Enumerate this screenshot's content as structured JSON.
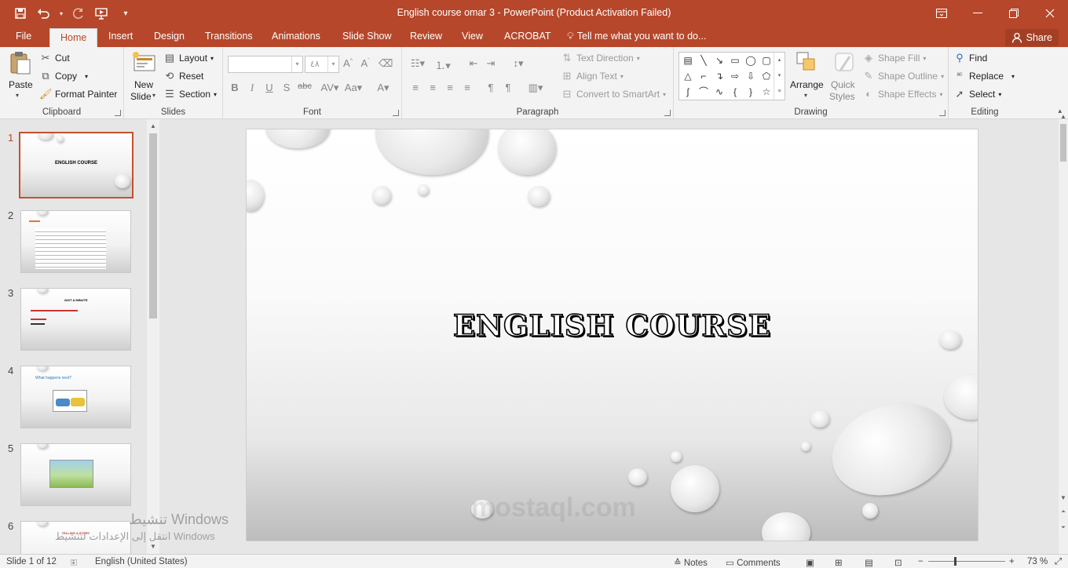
{
  "window": {
    "title": "English course omar 3 - PowerPoint (Product Activation Failed)",
    "qat_icons": [
      "save-icon",
      "undo-icon",
      "redo-icon",
      "start-from-beginning-icon",
      "customize-qat-icon"
    ]
  },
  "tabs": {
    "file": "File",
    "items": [
      "Home",
      "Insert",
      "Design",
      "Transitions",
      "Animations",
      "Slide Show",
      "Review",
      "View",
      "ACROBAT"
    ],
    "active": "Home",
    "tell_me": "Tell me what you want to do...",
    "share": "Share"
  },
  "ribbon": {
    "clipboard": {
      "paste": "Paste",
      "cut": "Cut",
      "copy": "Copy",
      "format_painter": "Format Painter",
      "label": "Clipboard"
    },
    "slides": {
      "new_slide": "New",
      "new_slide2": "Slide",
      "layout": "Layout",
      "reset": "Reset",
      "section": "Section",
      "label": "Slides"
    },
    "font": {
      "font_name": "",
      "font_size": "٤٨",
      "bold": "B",
      "italic": "I",
      "underline": "U",
      "shadow": "S",
      "strike": "abc",
      "label": "Font"
    },
    "paragraph": {
      "text_direction": "Text Direction",
      "align_text": "Align Text",
      "convert_smartart": "Convert to SmartArt",
      "label": "Paragraph"
    },
    "drawing": {
      "arrange": "Arrange",
      "quick_styles": "Quick",
      "quick_styles2": "Styles",
      "shape_fill": "Shape Fill",
      "shape_outline": "Shape Outline",
      "shape_effects": "Shape Effects",
      "label": "Drawing"
    },
    "editing": {
      "find": "Find",
      "replace": "Replace",
      "select": "Select",
      "label": "Editing"
    }
  },
  "thumbnails": [
    {
      "number": "1",
      "title": "ENGLISH COURSE",
      "selected": true
    },
    {
      "number": "2",
      "title": "",
      "selected": false
    },
    {
      "number": "3",
      "title": "JUST A MINUTE",
      "selected": false
    },
    {
      "number": "4",
      "title": "What happens next?",
      "selected": false
    },
    {
      "number": "5",
      "title": "",
      "selected": false
    },
    {
      "number": "6",
      "title": "TELLING A STORY",
      "selected": false
    }
  ],
  "slide": {
    "title": "ENGLISH COURSE"
  },
  "watermark": {
    "line1": "تنشيط Windows",
    "line2": "انتقل إلى الإعدادات لتنشيط Windows",
    "site": "mostaql.com"
  },
  "status": {
    "slide_info": "Slide 1 of 12",
    "language": "English (United States)",
    "notes": "Notes",
    "comments": "Comments",
    "zoom": "73 %"
  },
  "colors": {
    "accent": "#b7472a",
    "selected_border": "#c5502e"
  }
}
